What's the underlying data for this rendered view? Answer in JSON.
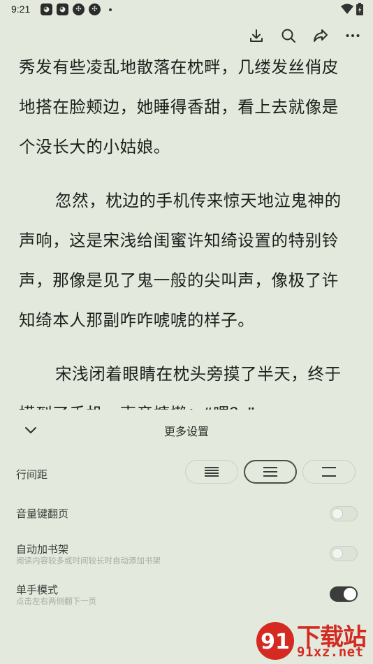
{
  "status_bar": {
    "time": "9:21",
    "notification_icons": [
      "cat-app-icon",
      "cat-app-icon",
      "pinwheel-app-icon",
      "pinwheel-app-icon"
    ],
    "system_icons": [
      "wifi-icon",
      "battery-charging-icon"
    ]
  },
  "toolbar": {
    "icons": [
      "download-icon",
      "search-icon",
      "share-icon",
      "more-icon"
    ]
  },
  "reader": {
    "paragraphs": [
      "秀发有些凌乱地散落在枕畔，几缕发丝俏皮地搭在脸颊边，她睡得香甜，看上去就像是个没长大的小姑娘。",
      "忽然，枕边的手机传来惊天地泣鬼神的声响，这是宋浅给闺蜜许知绮设置的特别铃声，那像是见了鬼一般的尖叫声，像极了许知绮本人那副咋咋唬唬的样子。",
      "宋浅闭着眼睛在枕头旁摸了半天，终于摸到了手机，声音慵懒：“喂？”"
    ]
  },
  "panel": {
    "title": "更多设置",
    "line_spacing": {
      "label": "行间距",
      "options": [
        "narrow",
        "medium",
        "wide"
      ],
      "selected": "medium"
    },
    "volume_key_page_turn": {
      "label": "音量键翻页",
      "enabled": false
    },
    "auto_add_bookshelf": {
      "label": "自动加书架",
      "description": "阅读内容较多或时间较长时自动添加书架",
      "enabled": false
    },
    "one_hand_mode": {
      "label": "单手模式",
      "description": "点击左右两侧翻下一页",
      "enabled": true
    }
  },
  "watermark": {
    "text": "下载站",
    "domain": "91xz.net",
    "color": "#d42a22"
  },
  "colors": {
    "background": "#e3e9dc",
    "toggle_on": "#3a3d3a"
  }
}
